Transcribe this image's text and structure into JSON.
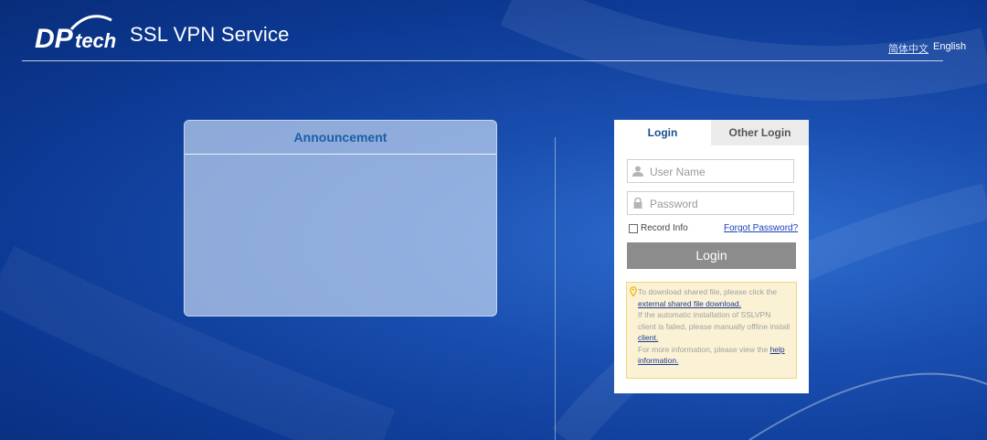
{
  "header": {
    "logo_text": "DPtech",
    "app_title": "SSL VPN Service",
    "languages": [
      "简体中文",
      "English"
    ]
  },
  "announcement": {
    "title": "Announcement"
  },
  "login": {
    "tabs": [
      "Login",
      "Other Login"
    ],
    "username_placeholder": "User Name",
    "password_placeholder": "Password",
    "record_info": "Record Info",
    "forgot_password": "Forgot Password?",
    "login_button": "Login",
    "notice": {
      "line1": "To download shared file, please click the",
      "link1": "external shared file download.",
      "line2": "If the automatic installation of SSLVPN client is failed, please manually offline install",
      "link2": "client.",
      "line3": "For more information, please view the",
      "link3": "help information."
    }
  },
  "colors": {
    "accent": "#1d5ea8",
    "login_button": "#8c8c8c",
    "notice_bg": "#fbf2d5",
    "notice_border": "#f3d57a"
  },
  "icons": [
    "user-icon",
    "lock-icon",
    "location-pin-icon"
  ]
}
